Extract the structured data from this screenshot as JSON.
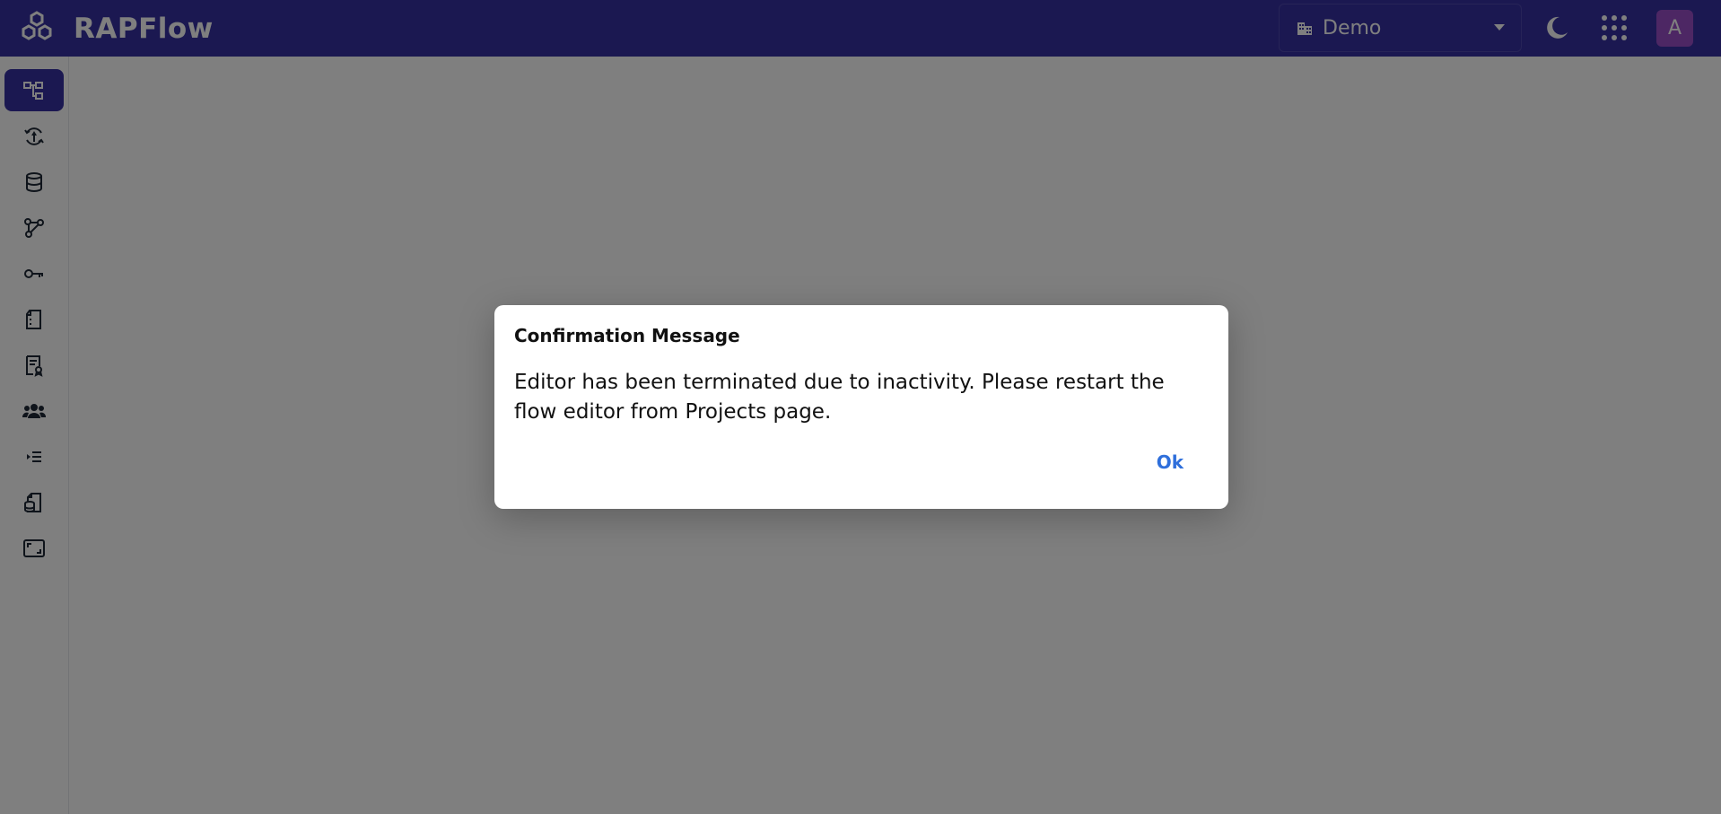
{
  "app": {
    "name": "RAPFlow"
  },
  "header": {
    "org_selector": {
      "value": "Demo"
    },
    "avatar_initial": "A"
  },
  "sidebar": {
    "items": [
      {
        "icon": "flow-hierarchy-icon",
        "active": true
      },
      {
        "icon": "deploy-cycle-icon"
      },
      {
        "icon": "database-icon"
      },
      {
        "icon": "graph-nodes-icon"
      },
      {
        "icon": "key-icon"
      },
      {
        "icon": "document-icon"
      },
      {
        "icon": "certificate-document-icon"
      },
      {
        "icon": "users-group-icon"
      },
      {
        "icon": "list-indent-icon"
      },
      {
        "icon": "data-file-icon"
      },
      {
        "icon": "screen-expand-icon"
      }
    ]
  },
  "modal": {
    "title": "Confirmation Message",
    "message": "Editor has been terminated due to inactivity. Please restart the flow editor from Projects page.",
    "ok_label": "Ok"
  },
  "colors": {
    "header_bg": "#3730a3",
    "active_item_bg": "#3730a3",
    "avatar_bg": "#9b4fc9",
    "link_blue": "#2f6fdb",
    "overlay": "rgba(0,0,0,0.5)"
  }
}
